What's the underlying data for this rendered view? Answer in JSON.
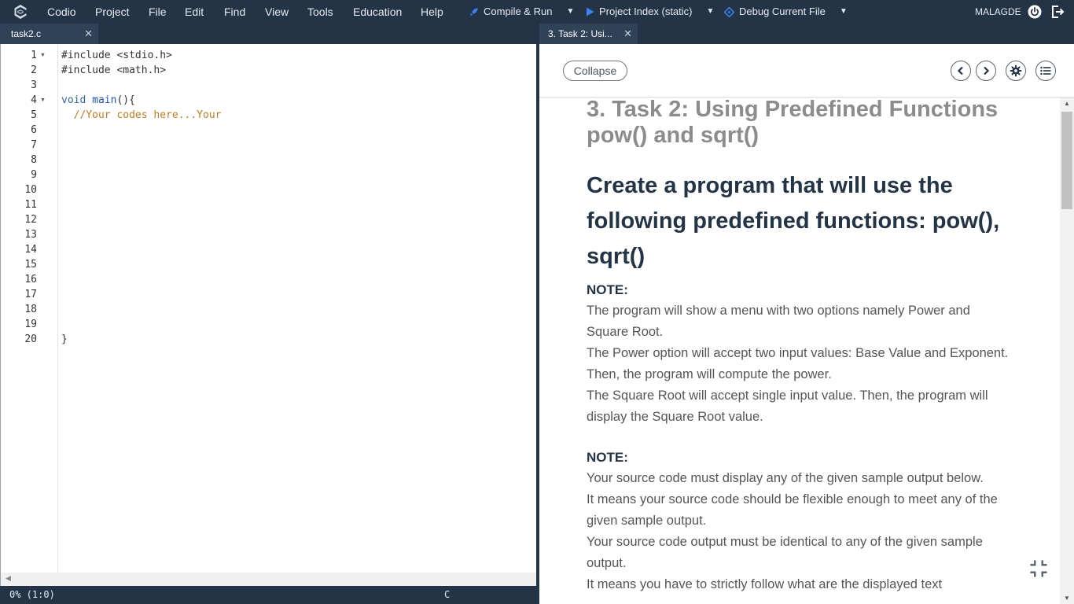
{
  "menubar": {
    "items": [
      "Codio",
      "Project",
      "File",
      "Edit",
      "Find",
      "View",
      "Tools",
      "Education",
      "Help"
    ],
    "compile_run": "Compile & Run",
    "project_index": "Project Index (static)",
    "debug": "Debug Current File",
    "user": "MALAGDE"
  },
  "editor": {
    "tab_label": "task2.c",
    "line_numbers": [
      "1",
      "2",
      "3",
      "4",
      "5",
      "6",
      "7",
      "8",
      "9",
      "10",
      "11",
      "12",
      "13",
      "14",
      "15",
      "16",
      "17",
      "18",
      "19",
      "20"
    ],
    "lines": {
      "l1": "#include <stdio.h>",
      "l2": "#include <math.h>",
      "l4_kw": "void",
      "l4_fn": "main",
      "l4_rest": "(){",
      "l5": "  //Your codes here...Your",
      "l20": "}"
    },
    "status_position": "0% (1:0)",
    "status_language": "C"
  },
  "guide": {
    "tab_label": "3. Task 2: Usi...",
    "collapse_label": "Collapse",
    "title": "3. Task 2: Using Predefined Functions pow() and sqrt()",
    "heading": "Create a program that will use the following predefined functions: pow(), sqrt()",
    "note1_label": "NOTE:",
    "note1_lines": [
      "The program will show a menu with two options namely Power and Square Root.",
      "The Power option will accept two input values: Base Value and Exponent. Then, the program will compute the power.",
      "The Square Root will accept single input value. Then, the program will display the Square Root value."
    ],
    "note2_label": "NOTE:",
    "note2_lines": [
      "Your source code must display any of the given sample output below.",
      "It means your source code should be flexible enough to meet any of the given sample output.",
      "Your source code output must be identical to any of the given sample output.",
      "It means you have to strictly follow what are the displayed text"
    ]
  },
  "colors": {
    "chrome": "#243447",
    "accent_blue": "#3b82f6",
    "title_gray": "#8c8c8c",
    "comment_orange": "#c87a1d"
  }
}
